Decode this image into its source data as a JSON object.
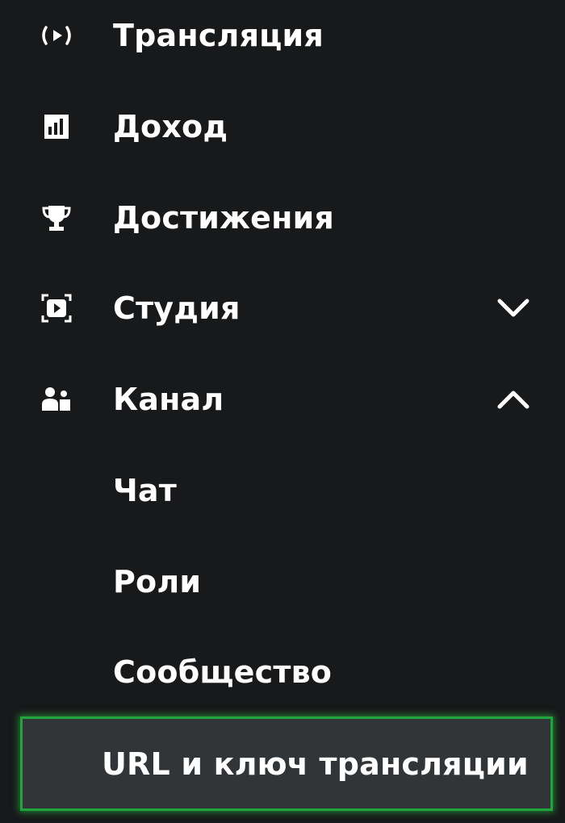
{
  "menu": {
    "items": [
      {
        "label": "Трансляция",
        "icon": "broadcast-icon"
      },
      {
        "label": "Доход",
        "icon": "bar-chart-icon"
      },
      {
        "label": "Достижения",
        "icon": "trophy-icon"
      },
      {
        "label": "Студия",
        "icon": "studio-icon",
        "chevron": "chevron-down-icon",
        "expanded": false
      },
      {
        "label": "Канал",
        "icon": "channel-icon",
        "chevron": "chevron-up-icon",
        "expanded": true
      }
    ],
    "channel_subitems": [
      {
        "label": "Чат"
      },
      {
        "label": "Роли"
      },
      {
        "label": "Сообщество"
      },
      {
        "label": "URL и ключ трансляции",
        "selected": true
      }
    ]
  },
  "colors": {
    "background": "#18191b",
    "text": "#ffffff",
    "selected_background": "#323538",
    "selected_border": "#1fa53c"
  }
}
